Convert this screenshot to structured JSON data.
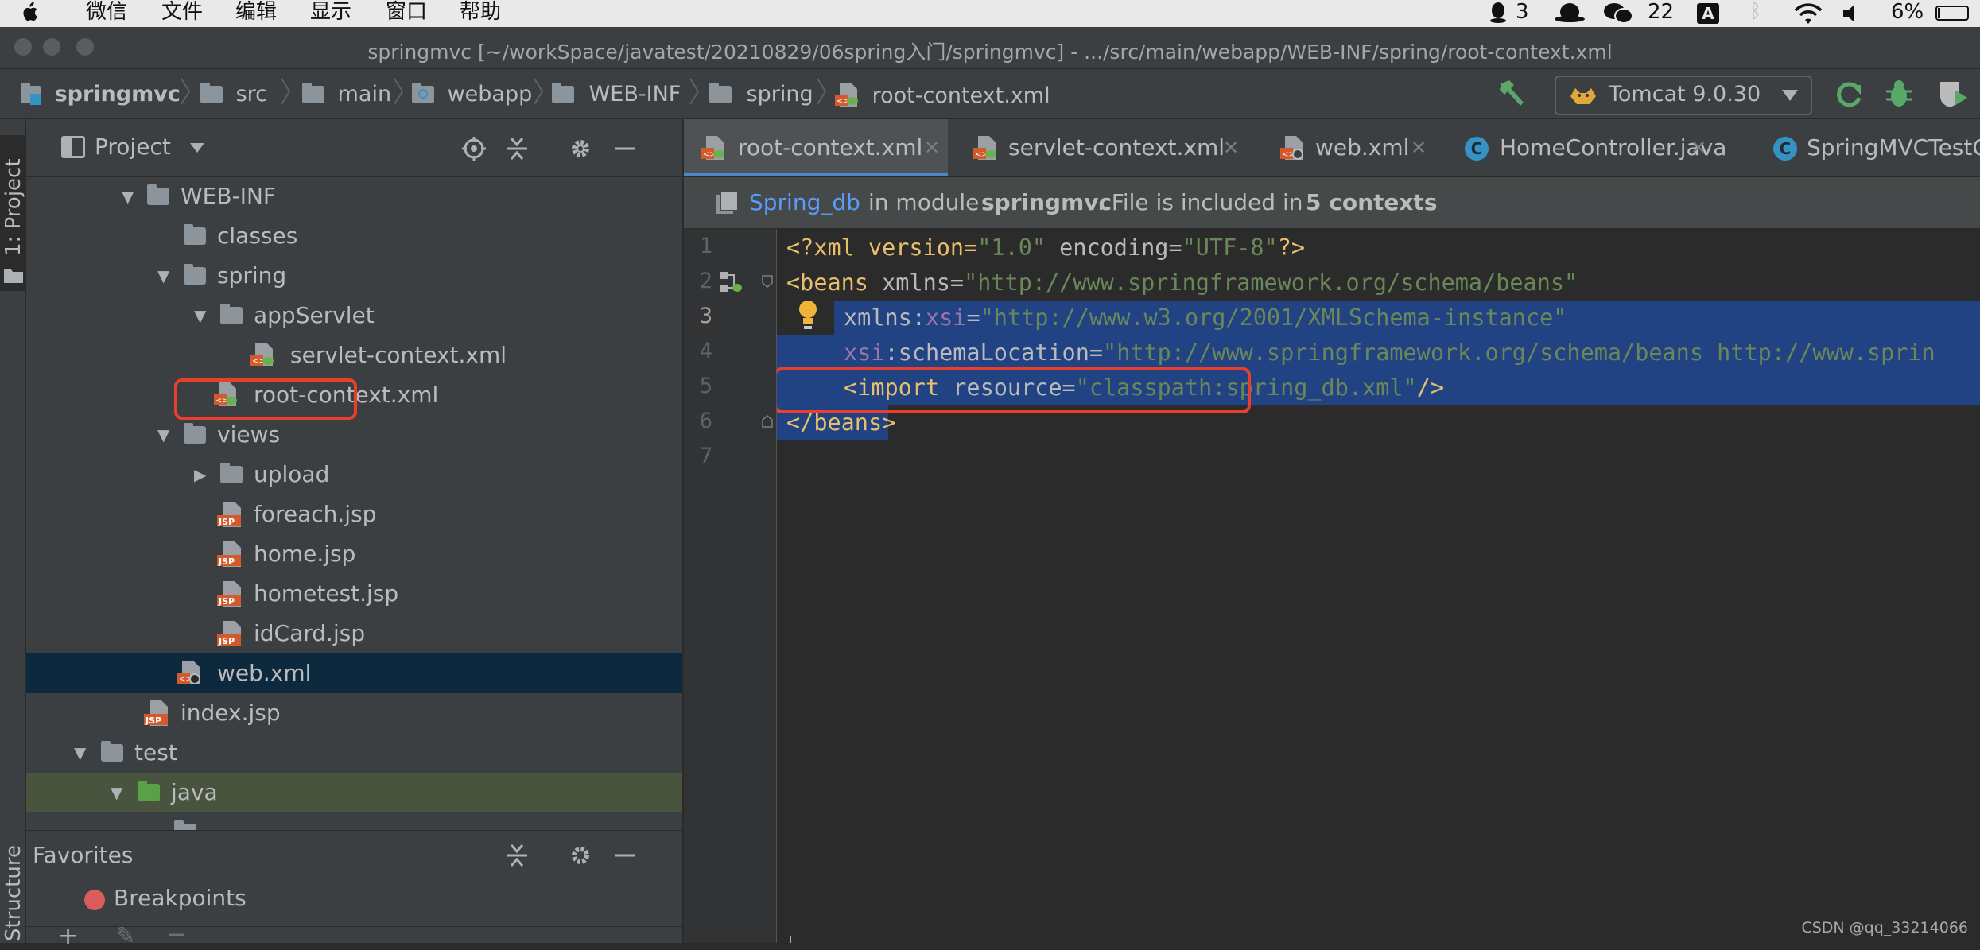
{
  "menubar": {
    "items": [
      "微信",
      "文件",
      "编辑",
      "显示",
      "窗口",
      "帮助"
    ],
    "tray": {
      "qq_count": "3",
      "wechat_count": "22",
      "input_method": "A",
      "battery": "6%"
    }
  },
  "window": {
    "title": "springmvc [~/workSpace/javatest/20210829/06spring入门/springmvc] - .../src/main/webapp/WEB-INF/spring/root-context.xml"
  },
  "breadcrumb": [
    "springmvc",
    "src",
    "main",
    "webapp",
    "WEB-INF",
    "spring",
    "root-context.xml"
  ],
  "run_config": {
    "label": "Tomcat 9.0.30"
  },
  "left_stripe": {
    "project_tab": "1: Project",
    "structure_tab": "Structure"
  },
  "project_panel": {
    "title": "Project",
    "tree": [
      {
        "label": "WEB-INF",
        "type": "folder",
        "expanded": true
      },
      {
        "label": "classes",
        "type": "folder"
      },
      {
        "label": "spring",
        "type": "folder",
        "expanded": true
      },
      {
        "label": "appServlet",
        "type": "folder",
        "expanded": true
      },
      {
        "label": "servlet-context.xml",
        "type": "xml"
      },
      {
        "label": "root-context.xml",
        "type": "xml"
      },
      {
        "label": "views",
        "type": "folder",
        "expanded": true
      },
      {
        "label": "upload",
        "type": "folder",
        "expanded": false
      },
      {
        "label": "foreach.jsp",
        "type": "jsp"
      },
      {
        "label": "home.jsp",
        "type": "jsp"
      },
      {
        "label": "hometest.jsp",
        "type": "jsp"
      },
      {
        "label": "idCard.jsp",
        "type": "jsp"
      },
      {
        "label": "web.xml",
        "type": "webxml"
      },
      {
        "label": "index.jsp",
        "type": "jsp"
      },
      {
        "label": "test",
        "type": "folder",
        "expanded": true
      },
      {
        "label": "java",
        "type": "folder-green",
        "expanded": true
      }
    ]
  },
  "favorites": {
    "title": "Favorites",
    "items": [
      "Breakpoints"
    ]
  },
  "tabs": [
    "root-context.xml",
    "servlet-context.xml",
    "web.xml",
    "HomeController.java",
    "SpringMVCTestC"
  ],
  "banner": {
    "link": "Spring_db",
    "pre": "in module",
    "module": "springmvc",
    "mid": ". File is included in",
    "count": "5 contexts",
    "end": "."
  },
  "code": {
    "line_numbers": [
      "1",
      "2",
      "3",
      "4",
      "5",
      "6",
      "7"
    ],
    "l1": {
      "a": "<?xml version=",
      "b": "\"1.0\"",
      "c": " encoding=",
      "d": "\"UTF-8\"",
      "e": "?>"
    },
    "l2": {
      "a": "<beans",
      "b": " xmlns=",
      "c": "\"http://www.springframework.org/schema/beans\""
    },
    "l3": {
      "a": "xmlns:",
      "b": "xsi",
      "c": "=",
      "d": "\"http://www.w3.org/2001/XMLSchema-instance\""
    },
    "l4": {
      "a": "xsi",
      "b": ":schemaLocation=",
      "c": "\"http://www.springframework.org/schema/beans http://www.sprin"
    },
    "l5": {
      "a": "<import",
      "b": " resource=",
      "c": "\"classpath:spring_db.xml\"",
      "d": "/>"
    },
    "l6": {
      "a": "</beans>"
    }
  },
  "watermark": "CSDN @qq_33214066",
  "colors": {
    "accent": "#4a88c7",
    "highlight_box": "#e8402c",
    "selection": "#214283"
  }
}
